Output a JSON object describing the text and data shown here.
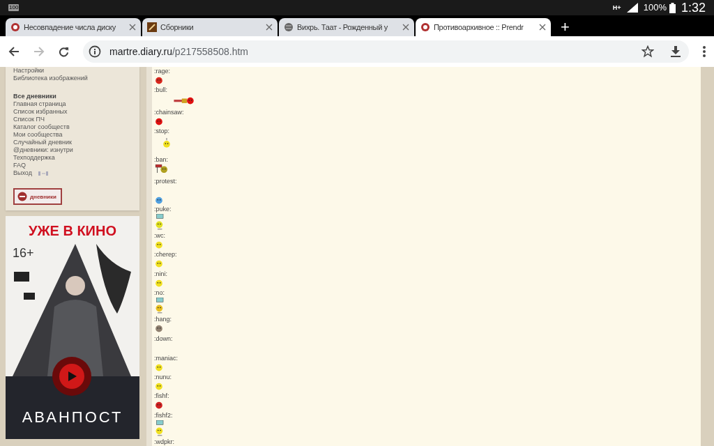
{
  "status_bar": {
    "battery_badge": "100",
    "network": "H+",
    "battery": "100%",
    "time": "1:32"
  },
  "tabs": [
    {
      "title": "Несовпадение числа диску",
      "selected": false,
      "kind": "diary"
    },
    {
      "title": "Сборники",
      "selected": false,
      "kind": "quill"
    },
    {
      "title": "Вихрь. Таат - Рожденный у",
      "selected": false,
      "kind": "globe"
    },
    {
      "title": "Противоархивное :: Prendr",
      "selected": true,
      "kind": "diary"
    }
  ],
  "new_tab": "+",
  "address": {
    "host": "martre.diary.ru",
    "path": "/p217558508.htm"
  },
  "sidebar": {
    "top_links": [
      "Настройки",
      "Библиотека изображений"
    ],
    "heading": "Все дневники",
    "links": [
      "Главная страница",
      "Список избранных",
      "Список ПЧ",
      "Каталог сообществ",
      "Мои сообщества",
      "Случайный дневник",
      "@дневники: изнутри",
      "Техподдержка",
      "FAQ"
    ],
    "logout": "Выход",
    "logo": "дневники"
  },
  "ad": {
    "headline": "УЖЕ В КИНО",
    "rating": "16+",
    "title": "АВАНПОСТ"
  },
  "smileys": [
    {
      "label": ":rage:",
      "kind": "face",
      "color": "#d8261c"
    },
    {
      "label": ":bull:",
      "kind": "wide",
      "color": "#e01010"
    },
    {
      "label": ":chainsaw:",
      "kind": "face",
      "color": "#e01010"
    },
    {
      "label": ":stop:",
      "kind": "indent",
      "color": "#f0e020"
    },
    {
      "label": ":ban:",
      "kind": "sign",
      "color": "#b0a020"
    },
    {
      "label": ":protest:",
      "kind": "indent-low",
      "color": "#50a0e0"
    },
    {
      "label": ":puke:",
      "kind": "tall",
      "color": "#e0e020"
    },
    {
      "label": ":wc:",
      "kind": "face",
      "color": "#f0e020"
    },
    {
      "label": ":cherep:",
      "kind": "face",
      "color": "#f0e020"
    },
    {
      "label": ":nini:",
      "kind": "face",
      "color": "#f0e020"
    },
    {
      "label": ":no:",
      "kind": "tall",
      "color": "#e8c020"
    },
    {
      "label": ":hang:",
      "kind": "face",
      "color": "#908070"
    },
    {
      "label": ":down:",
      "kind": "none"
    },
    {
      "label": ":maniac:",
      "kind": "face",
      "color": "#f0e020"
    },
    {
      "label": ":nunu:",
      "kind": "face",
      "color": "#f0e020"
    },
    {
      "label": ":fishf:",
      "kind": "face",
      "color": "#d02020"
    },
    {
      "label": ":fishf2:",
      "kind": "tall",
      "color": "#f0e020"
    },
    {
      "label": ":wdpkr:",
      "kind": "none"
    }
  ]
}
